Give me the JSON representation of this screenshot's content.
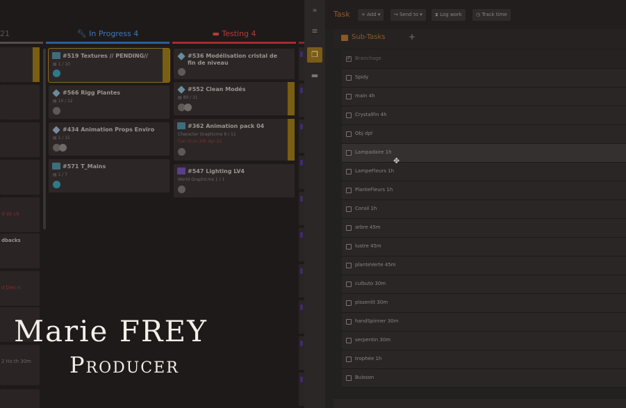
{
  "kanban": {
    "columns": {
      "left_partial": {
        "label": "21"
      },
      "in_progress": {
        "label": "In Progress 4"
      },
      "testing": {
        "label": "Testing 4"
      }
    },
    "left_cards": [
      "d Vo ch",
      "dbacks",
      "d Dev n",
      "2 Hz.th 30m"
    ],
    "in_progress_cards": [
      {
        "title": "#519 Textures // PENDING//",
        "meta": "1 / 10"
      },
      {
        "title": "#566 Rigg Plantes",
        "meta": "10 / 12"
      },
      {
        "title": "#434 Animation Props Enviro",
        "meta": "1 / 15"
      },
      {
        "title": "#571 T_Mains",
        "meta": "1 / 7"
      }
    ],
    "testing_cards": [
      {
        "title": "#536 Modélisation cristal de fin de niveau",
        "meta": ""
      },
      {
        "title": "#552 Clean Modés",
        "meta": "89 / 31"
      },
      {
        "title": "#362 Animation pack 04",
        "meta": "Character Graphicme   8 / 11",
        "meta2": "Can Grun 10h   Apr 22"
      },
      {
        "title": "#547 Lighting LV4",
        "meta": "World Graphicme   1 / 1"
      }
    ]
  },
  "toolbar": {
    "collapse_icon": "double-chevron-icon",
    "menu_icon": "menu-icon",
    "subtasks_icon": "stack-icon",
    "comments_icon": "chat-icon"
  },
  "task": {
    "title": "Task",
    "buttons": {
      "add": "+ Add ▾",
      "send_to": "↪ Send to ▾",
      "log_work": "⧗ Log work",
      "track_time": "◷ Track time"
    },
    "subtasks_label": "Sub-Tasks",
    "add_icon": "+",
    "subtasks": [
      {
        "label": "Branchage",
        "checked": true
      },
      {
        "label": "Spidy",
        "checked": false
      },
      {
        "label": "main 4h",
        "checked": false
      },
      {
        "label": "CrystalFin 4h",
        "checked": false
      },
      {
        "label": "Obj dpl",
        "checked": false
      },
      {
        "label": "Lampadaire 1h",
        "checked": false
      },
      {
        "label": "LampeFleurs 1h",
        "checked": false
      },
      {
        "label": "PlanteFleurs 1h",
        "checked": false
      },
      {
        "label": "Corail 1h",
        "checked": false
      },
      {
        "label": "arbre 45m",
        "checked": false
      },
      {
        "label": "lustre 45m",
        "checked": false
      },
      {
        "label": "planteVerte 45m",
        "checked": false
      },
      {
        "label": "culbuto 30m",
        "checked": false
      },
      {
        "label": "pissenlit 30m",
        "checked": false
      },
      {
        "label": "handSpinner 30m",
        "checked": false
      },
      {
        "label": "serpentin 30m",
        "checked": false
      },
      {
        "label": "trophée 1h",
        "checked": false
      },
      {
        "label": "Buisson",
        "checked": false
      }
    ]
  },
  "overlay": {
    "name": "Marie FREY",
    "role": "Producer"
  },
  "colors": {
    "accent": "#7a5c16",
    "in_progress": "#3f78b6",
    "testing": "#b63b3b"
  }
}
